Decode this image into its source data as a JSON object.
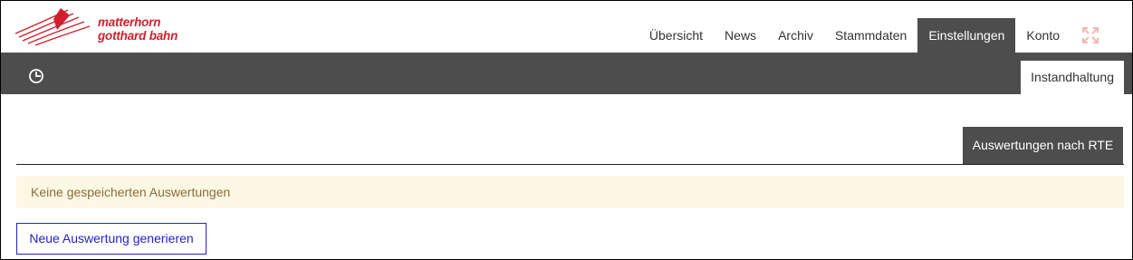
{
  "brand": {
    "line1": "matterhorn",
    "line2": "gotthard bahn",
    "color": "#d0202e"
  },
  "nav": {
    "items": [
      "Übersicht",
      "News",
      "Archiv",
      "Stammdaten",
      "Einstellungen",
      "Konto"
    ],
    "active": "Einstellungen",
    "fullscreen_icon": "expand-icon"
  },
  "subbar": {
    "icon": "clock-icon",
    "tab_label": "Instandhaltung"
  },
  "main": {
    "section_tab": "Auswertungen nach RTE",
    "notice": "Keine gespeicherten Auswertungen",
    "new_button": "Neue Auswertung generieren"
  },
  "colors": {
    "dark_bar": "#4d4d4d",
    "notice_bg": "#fcf8e3",
    "notice_text": "#8a6d3b",
    "link_blue": "#2222cc"
  }
}
